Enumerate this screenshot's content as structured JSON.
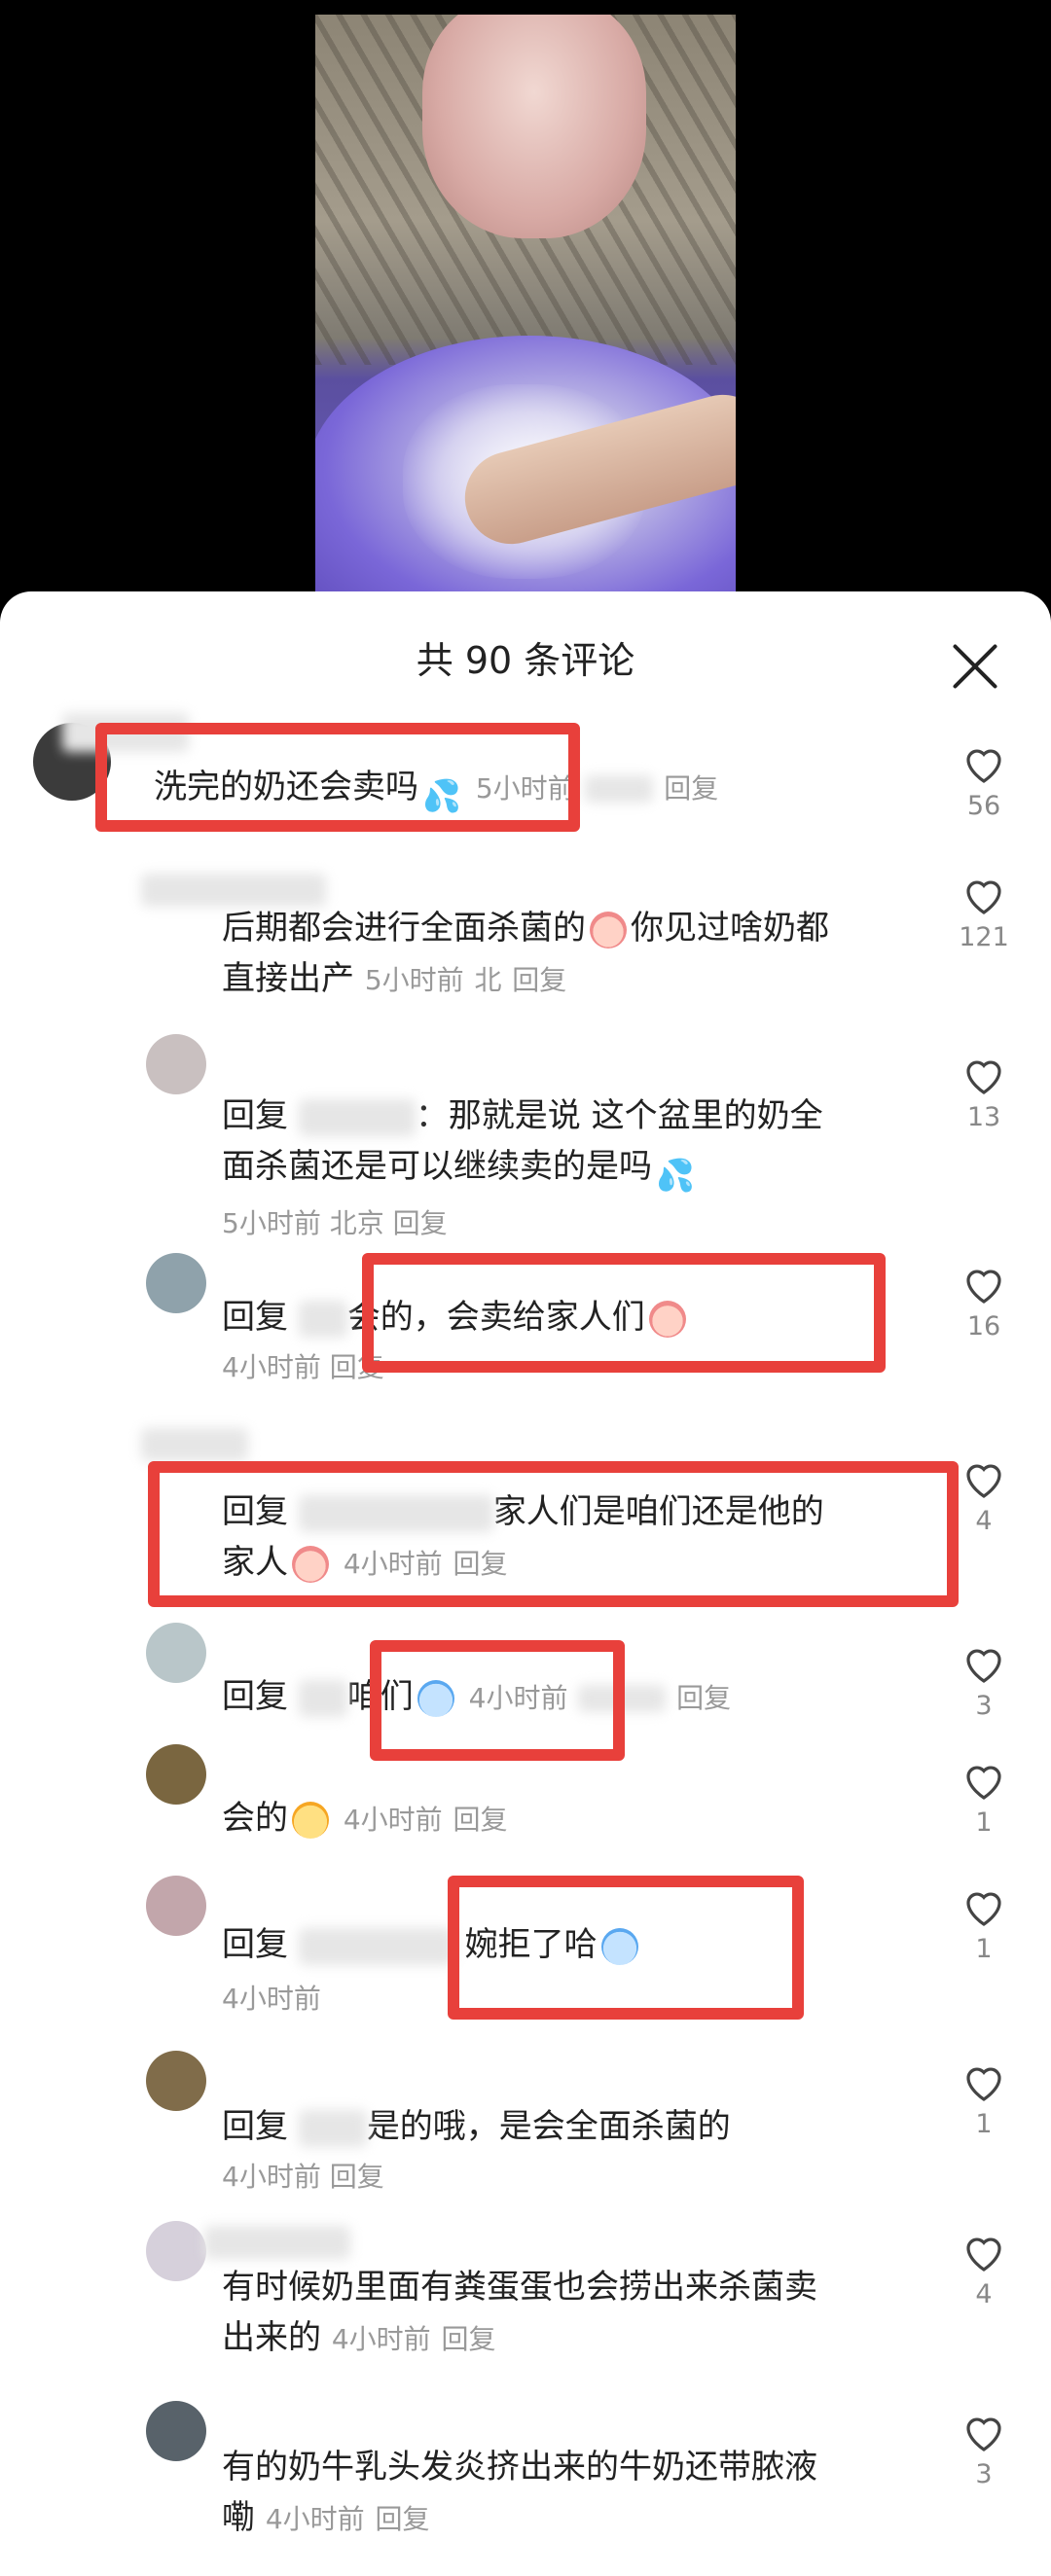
{
  "video": {
    "description_icon": "video-frame"
  },
  "sheet": {
    "title": "共 90 条评论",
    "close_icon": "close-icon"
  },
  "comments": [
    {
      "text": "洗完的奶还会卖吗",
      "time": "5小时前",
      "reply": "回复",
      "likes": "56"
    },
    {
      "text_line1": "后期都会进行全面杀菌的",
      "text_line1b": "你见过啥奶都",
      "text_line2": "直接出产",
      "time": "5小时前",
      "loc": "北",
      "reply": "回复",
      "likes": "121"
    },
    {
      "prefix": "回复",
      "text_line1": "：那就是说 这个盆里的奶全",
      "text_line2": "面杀菌还是可以继续卖的是吗",
      "time": "5小时前",
      "loc": "北京",
      "reply": "回复",
      "likes": "13"
    },
    {
      "prefix": "回复",
      "text": "会的，会卖给家人们",
      "time": "4小时前",
      "reply": "回复",
      "likes": "16"
    },
    {
      "prefix": "回复",
      "text_line1": "家人们是咱们还是他的",
      "text_line2": "家人",
      "time": "4小时前",
      "reply": "回复",
      "likes": "4"
    },
    {
      "prefix": "回复",
      "text": "咱们",
      "time": "4小时前",
      "reply": "回复",
      "likes": "3"
    },
    {
      "text": "会的",
      "time": "4小时前",
      "reply": "回复",
      "likes": "1"
    },
    {
      "prefix": "回复",
      "text": "婉拒了哈",
      "time": "4小时前",
      "likes": "1"
    },
    {
      "prefix": "回复",
      "text": "是的哦，是会全面杀菌的",
      "time": "4小时前",
      "reply": "回复",
      "likes": "1"
    },
    {
      "text_line1": "有时候奶里面有粪蛋蛋也会捞出来杀菌卖",
      "text_line2": "出来的",
      "time": "4小时前",
      "reply": "回复",
      "likes": "4"
    },
    {
      "text_line1": "有的奶牛乳头发炎挤出来的牛奶还带脓液",
      "text_line2": "嘞",
      "time": "4小时前",
      "reply": "回复",
      "likes": "3"
    }
  ],
  "colors": {
    "highlight": "#e8403b",
    "meta": "#999999",
    "text": "#222222"
  }
}
